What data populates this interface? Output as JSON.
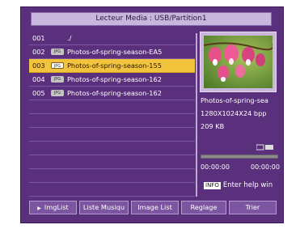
{
  "title": "Lecteur Media  : USB/Partition1",
  "files": [
    {
      "num": "001",
      "name": "./",
      "type": "dir",
      "selected": false
    },
    {
      "num": "002",
      "name": "Photos-of-spring-season-EA5",
      "type": "image",
      "selected": false
    },
    {
      "num": "003",
      "name": "Photos-of-spring-season-155",
      "type": "image",
      "selected": true
    },
    {
      "num": "004",
      "name": "Photos-of-spring-season-162",
      "type": "image",
      "selected": false
    },
    {
      "num": "005",
      "name": "Photos-of-spring-season-162",
      "type": "image",
      "selected": false
    }
  ],
  "preview": {
    "filename": "Photos-of-spring-sea",
    "resolution": "1280X1024X24 bpp",
    "size": "209 KB",
    "time_elapsed": "00:00:00",
    "time_total": "00:00:00",
    "progress": 0
  },
  "help": {
    "badge": "INFO",
    "text": "Enter help win"
  },
  "buttons": [
    {
      "label": "ImgList"
    },
    {
      "label": "Liste Musiqu"
    },
    {
      "label": "Image List"
    },
    {
      "label": "Reglage"
    },
    {
      "label": "Trier"
    }
  ],
  "colors": {
    "background": "#5a2f7c",
    "highlight": "#f2c43e",
    "title_bar": "#c9b6dc"
  }
}
